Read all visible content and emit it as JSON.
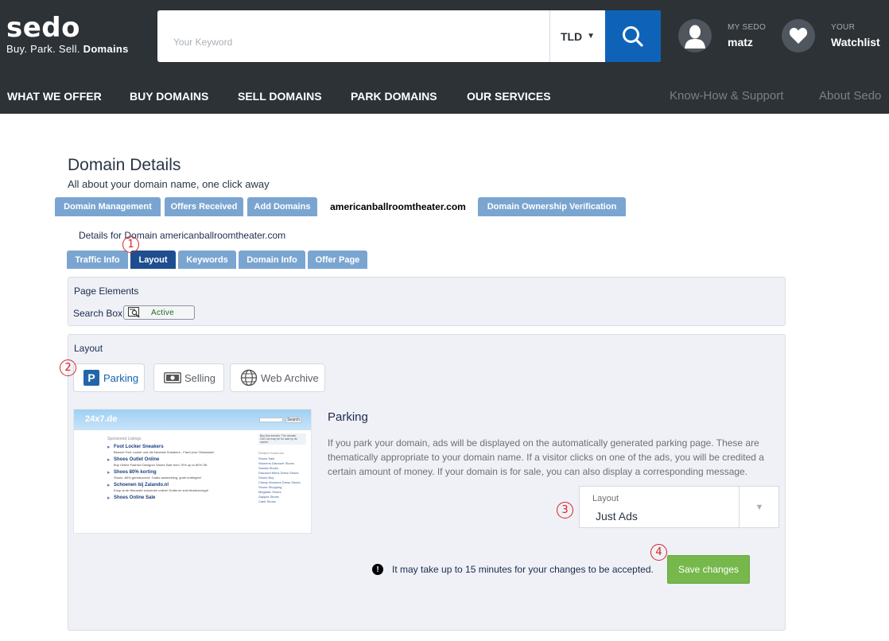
{
  "header": {
    "brand": "sedo",
    "tagline_prefix": "Buy. Park. Sell. ",
    "tagline_bold": "Domains",
    "search_placeholder": "Your Keyword",
    "tld_label": "TLD",
    "my_sedo_small": "MY SEDO",
    "my_sedo_user": "matz",
    "watch_small": "YOUR",
    "watch_big": "Watchlist"
  },
  "nav": {
    "items": [
      "WHAT WE OFFER",
      "BUY DOMAINS",
      "SELL DOMAINS",
      "PARK DOMAINS",
      "OUR SERVICES"
    ],
    "right": [
      "Know-How & Support",
      "About Sedo"
    ]
  },
  "page": {
    "title": "Domain Details",
    "subtitle": "All about your domain name, one click away"
  },
  "tabs_main": [
    "Domain Management",
    "Offers Received",
    "Add Domains",
    "americanballroomtheater.com",
    "Domain Ownership Verification"
  ],
  "details_for": "Details for Domain americanballroomtheater.com",
  "tabs_sub": [
    "Traffic Info",
    "Layout",
    "Keywords",
    "Domain Info",
    "Offer Page"
  ],
  "callouts": [
    "1",
    "2",
    "3",
    "4"
  ],
  "page_elements": {
    "title": "Page Elements",
    "search_box_label": "Search Box",
    "search_box_state": "Active"
  },
  "layout": {
    "title": "Layout",
    "options": [
      "Parking",
      "Selling",
      "Web Archive"
    ],
    "selected": "Parking",
    "heading": "Parking",
    "description": "If you park your domain, ads will be displayed on the automatically generated parking page. These are thematically appropriate to your domain name. If a visitor clicks on one of the ads, you will be credited a certain amount of money. If your domain is for sale, you can also display a corresponding message.",
    "select_label": "Layout",
    "select_value": "Just Ads",
    "notice": "It may take up to 15 minutes for your changes to be accepted.",
    "save_label": "Save changes"
  },
  "preview": {
    "logo": "24x7.de",
    "search_btn": "Search",
    "header": "Sponsored Listings",
    "items": [
      {
        "title": "Foot Locker Sneakers",
        "desc": "Besuch Foot Locker und die Neueste Sneakers - Fand your Obsession!"
      },
      {
        "title": "Shoes Outlet Online",
        "desc": "Buy Online Fashion Designer Shoes Sale from 70% up to 80% Off"
      },
      {
        "title": "Shoes 80% korting",
        "desc": "Shoes -80% gereduceerd. Gratis aanmelding, grote kortingen!"
      },
      {
        "title": "Schoenen bij Zalando.nl",
        "desc": "Koop al de Nieuwste schoenen online! Gratis en snel thuisbezorgd!"
      },
      {
        "title": "Shoes Online Sale",
        "desc": ""
      }
    ],
    "side_box": "Buy this domain. The domain 24x7.de may be for sale by its owner!",
    "side_header": "Related Searches",
    "side_links": [
      "Shoes Sale",
      "Womens Discount Shoes",
      "Sandal Shoes",
      "Discount Mens Dress Shoes",
      "Shoes Buy",
      "Cheap Womens Dress Shoes",
      "Shoes Shopping",
      "Megastic Shoes",
      "Zappos Shoes",
      "Clark Shoes"
    ]
  }
}
